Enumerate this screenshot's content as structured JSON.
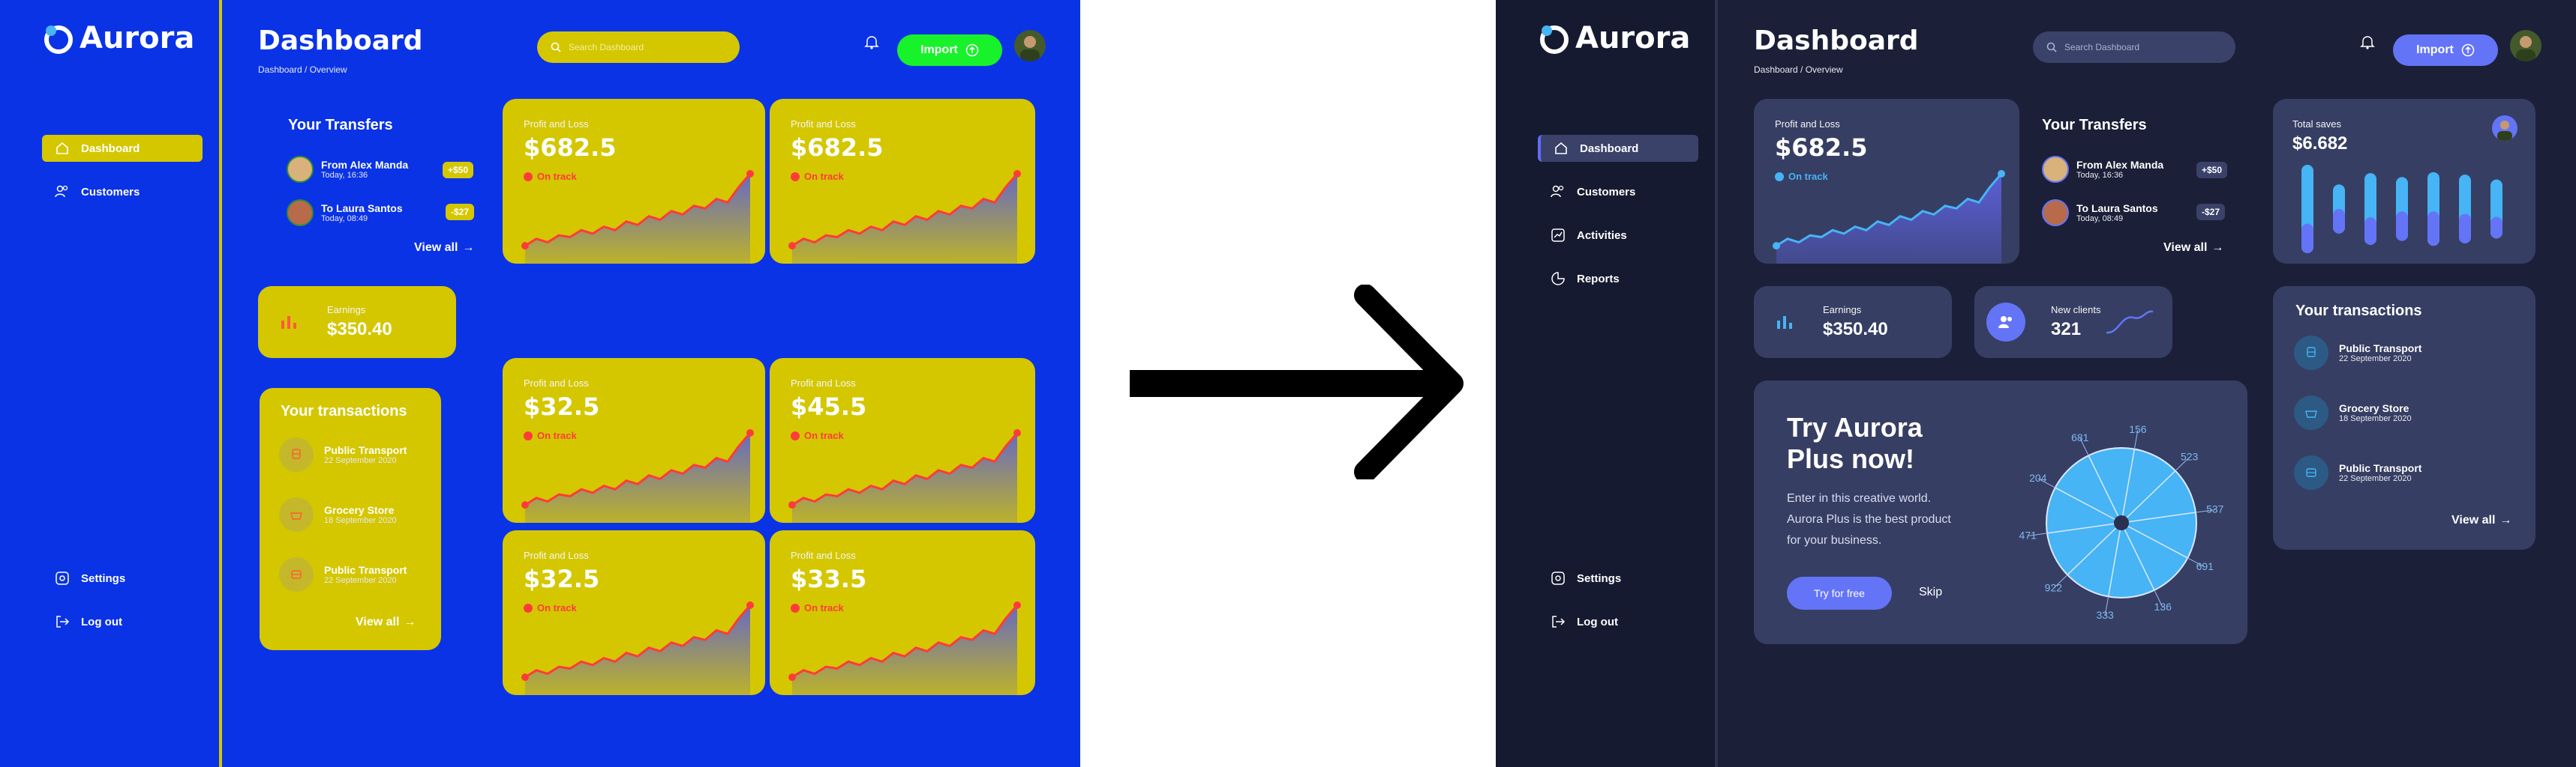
{
  "brand": "Aurora",
  "colors": {
    "left_bg": "#0a33e6",
    "left_accent": "#d4c700",
    "left_import": "#18f22a",
    "right_bg": "#1b2038",
    "right_card": "#363e63",
    "right_accent": "#6474f7",
    "chart_fill": "#5b5fd6",
    "chart_line_left": "#ff3b3b",
    "chart_line_right": "#46b4f5"
  },
  "header": {
    "title": "Dashboard",
    "breadcrumb": "Dashboard / Overview",
    "search_placeholder": "Search Dashboard",
    "import_label": "Import"
  },
  "nav": {
    "dashboard": "Dashboard",
    "customers": "Customers",
    "activities": "Activities",
    "reports": "Reports",
    "settings": "Settings",
    "logout": "Log out"
  },
  "transfers": {
    "title": "Your Transfers",
    "items": [
      {
        "name": "From Alex Manda",
        "date": "Today, 16:36",
        "amount": "+$50"
      },
      {
        "name": "To Laura Santos",
        "date": "Today, 08:49",
        "amount": "-$27"
      }
    ],
    "view_all": "View all"
  },
  "earnings": {
    "label": "Earnings",
    "value": "$350.40"
  },
  "new_clients": {
    "label": "New clients",
    "value": "321"
  },
  "pnl_label": "Profit and Loss",
  "on_track": "On track",
  "pnl_values": {
    "right": "$682.5",
    "left1": "$682.5",
    "left2": "$682.5",
    "left3": "$32.5",
    "left4": "$45.5",
    "left5": "$32.5",
    "left6": "$33.5"
  },
  "transactions": {
    "title": "Your transactions",
    "items": [
      {
        "name": "Public Transport",
        "date": "22 September 2020"
      },
      {
        "name": "Grocery Store",
        "date": "18 September 2020"
      },
      {
        "name": "Public Transport",
        "date": "22 September 2020"
      }
    ],
    "view_all": "View all"
  },
  "total_saves": {
    "label": "Total saves",
    "value": "$6.682"
  },
  "promo": {
    "title_line1": "Try Aurora",
    "title_line2": "Plus now!",
    "desc_line1": "Enter in this creative world.",
    "desc_line2": "Aurora Plus is the best product",
    "desc_line3": "for your business.",
    "try_label": "Try for free",
    "skip_label": "Skip"
  },
  "radial_labels": [
    "156",
    "523",
    "537",
    "691",
    "136",
    "333",
    "922",
    "471",
    "204",
    "681"
  ],
  "chart_data": [
    {
      "type": "area",
      "name": "Profit and Loss sparkline",
      "y": [
        12,
        20,
        16,
        24,
        22,
        30,
        26,
        34,
        30,
        40,
        36,
        46,
        42,
        52,
        48,
        58,
        55,
        66,
        62,
        80,
        95
      ]
    },
    {
      "type": "bar",
      "name": "Total saves",
      "categories": [
        "1",
        "2",
        "3",
        "4",
        "5",
        "6",
        "7"
      ],
      "series": [
        {
          "name": "top",
          "values": [
            60,
            25,
            45,
            35,
            40,
            40,
            38
          ]
        },
        {
          "name": "bottom",
          "values": [
            30,
            25,
            28,
            30,
            35,
            30,
            22
          ]
        }
      ]
    }
  ]
}
